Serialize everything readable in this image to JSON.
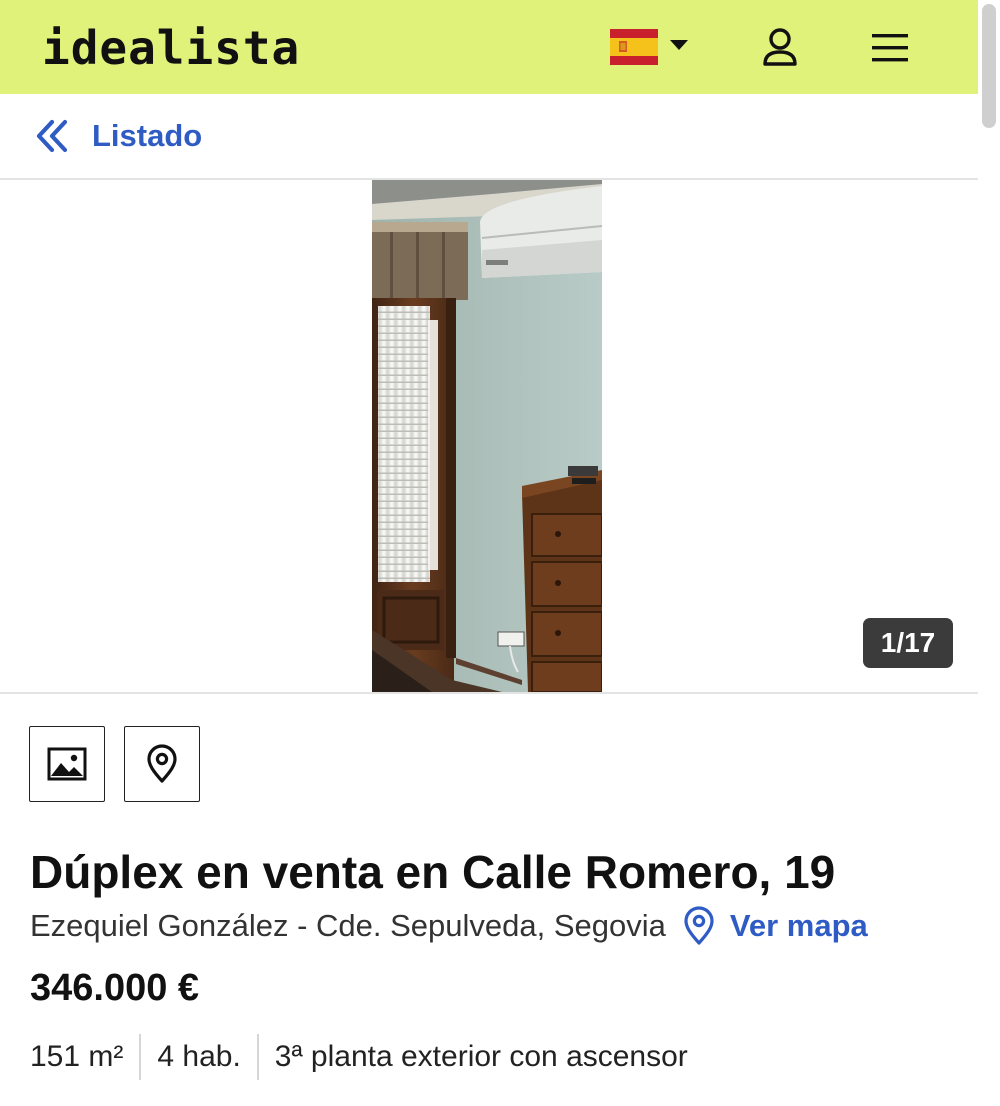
{
  "header": {
    "logo": "idealista",
    "language_flag": "spain-flag",
    "icons": [
      "chevron-down-icon",
      "user-icon",
      "menu-icon"
    ],
    "background_color": "#e1f27a"
  },
  "nav": {
    "back_label": "Listado",
    "back_icon": "double-chevron-left-icon",
    "link_color": "#2f5cc4"
  },
  "gallery": {
    "counter": "1/17"
  },
  "media_buttons": {
    "photos_icon": "image-icon",
    "map_icon": "location-pin-icon"
  },
  "listing": {
    "title": "Dúplex en venta en Calle Romero, 19",
    "location": "Ezequiel González - Cde. Sepulveda, Segovia",
    "map_link_label": "Ver mapa",
    "price": "346.000 €",
    "features": [
      "151 m²",
      "4 hab.",
      "3ª planta exterior con ascensor"
    ]
  }
}
